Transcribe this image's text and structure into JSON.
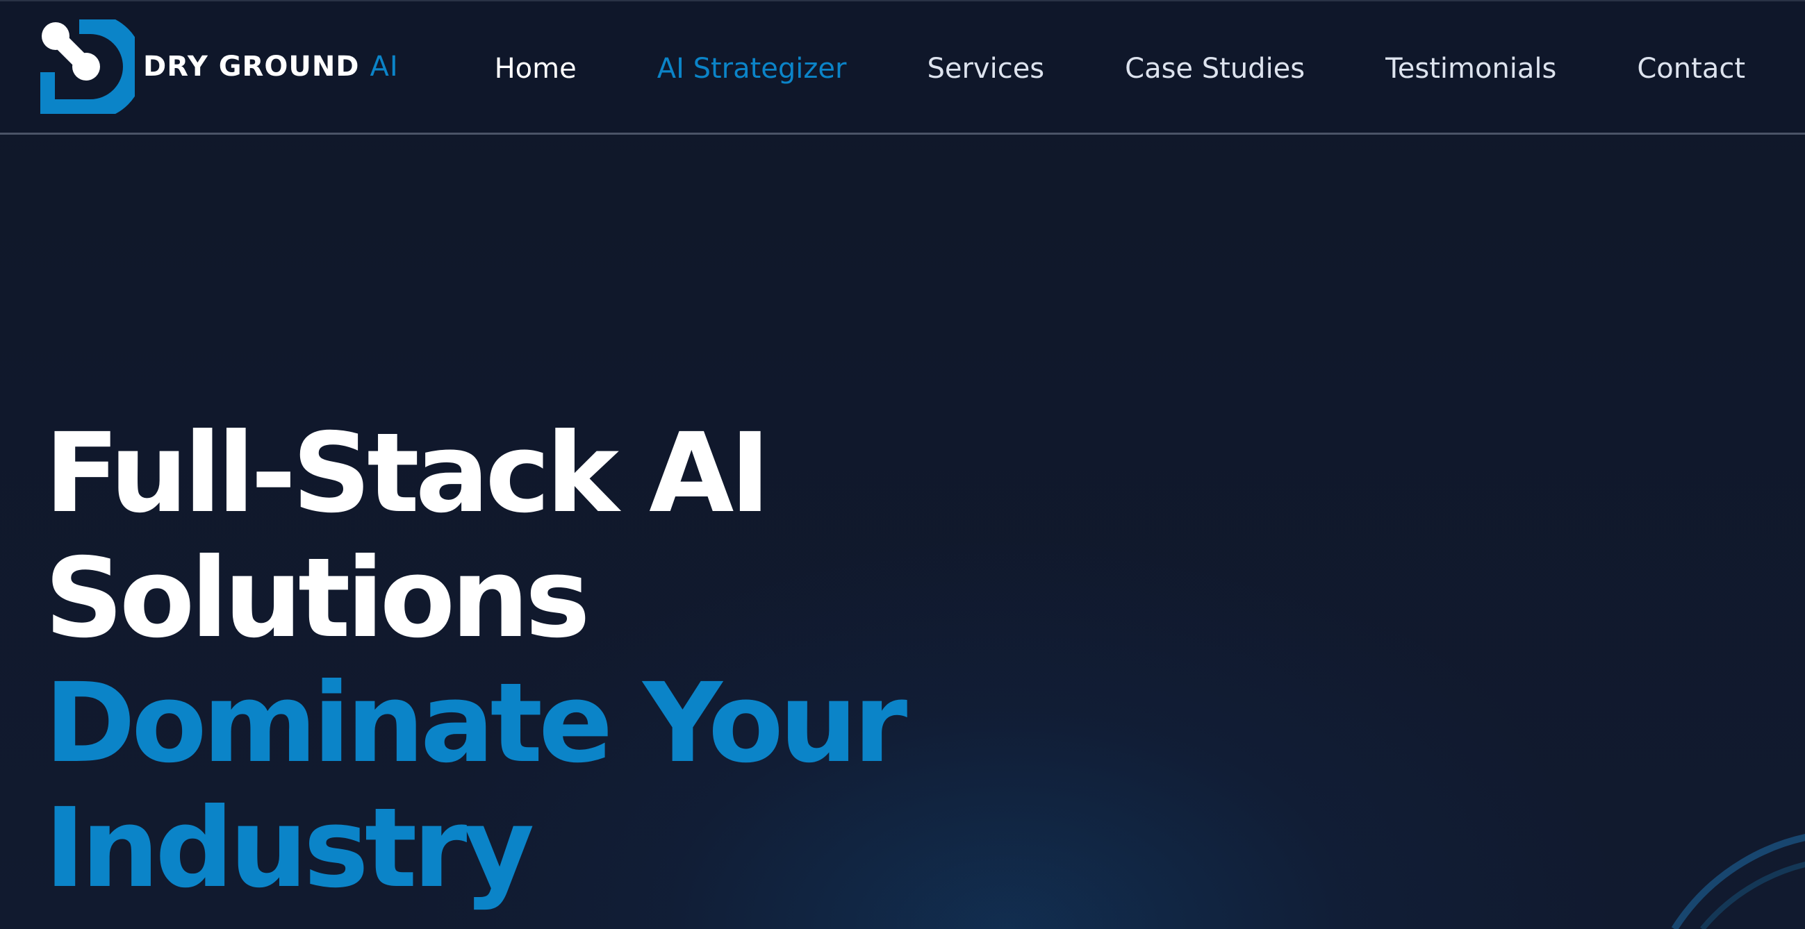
{
  "brand": {
    "name": "DRY GROUND",
    "accent": "AI",
    "logo_icon": "brand-logo-icon",
    "color_primary": "#0b84c8",
    "color_background": "#0f172a"
  },
  "nav": {
    "items": [
      {
        "label": "Home",
        "state": "default"
      },
      {
        "label": "AI Strategizer",
        "state": "active"
      },
      {
        "label": "Services",
        "state": "default"
      },
      {
        "label": "Case Studies",
        "state": "default"
      },
      {
        "label": "Testimonials",
        "state": "default"
      },
      {
        "label": "Contact",
        "state": "default"
      }
    ]
  },
  "hero": {
    "title_lines": [
      "Full-Stack AI",
      "Solutions"
    ],
    "accent_lines": [
      "Dominate Your",
      "Industry"
    ]
  }
}
